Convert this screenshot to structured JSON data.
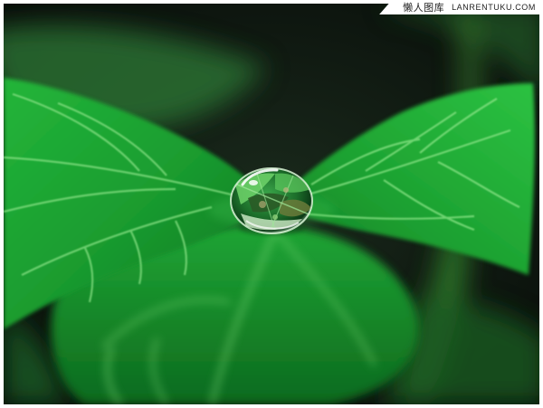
{
  "watermark": {
    "chinese": "懒人图库",
    "site": "LANRENTUKU.COM"
  },
  "scene": {
    "subject": "water droplet on green leaf",
    "colors": {
      "background": "#0d130f",
      "leaf_dark": "#0f7a22",
      "leaf_mid": "#1ea233",
      "leaf_light": "#38c54a",
      "vein": "#7fe07a",
      "stem": "#2f7a2a"
    }
  }
}
